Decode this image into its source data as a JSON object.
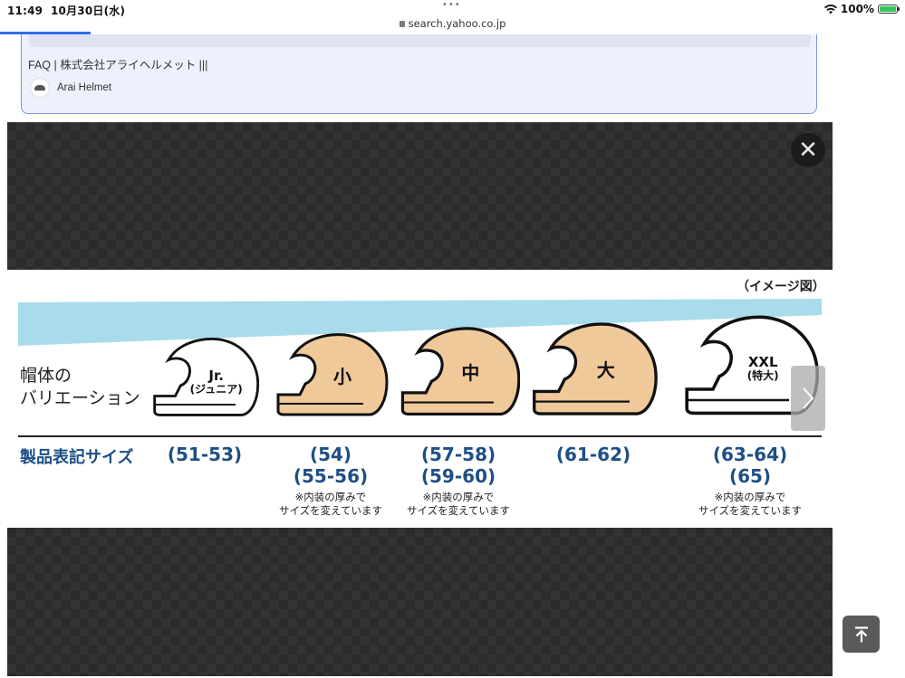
{
  "status_bar": {
    "time": "11:49",
    "date": "10月30日(水)",
    "dots": "•••",
    "url": "search.yahoo.co.jp",
    "battery": "100%",
    "progress_fraction": 0.1
  },
  "result_card": {
    "title": "FAQ | 株式会社アライヘルメット |||",
    "site_name": "Arai Helmet"
  },
  "viewer": {
    "close_glyph": "✕",
    "image": {
      "note": "（イメージ図）",
      "shell_label_line1": "帽体の",
      "shell_label_line2": "バリエーション",
      "product_label": "製品表記サイズ",
      "helmets": [
        {
          "label": "Jr.",
          "sublabel": "(ジュニア)",
          "color": "#ffffff",
          "sizes": [
            "(51-53)"
          ],
          "note": [
            "",
            ""
          ]
        },
        {
          "label": "小",
          "sublabel": "",
          "color": "#f0c99a",
          "sizes": [
            "(54)",
            "(55-56)"
          ],
          "note": [
            "※内装の厚みで",
            "サイズを変えています"
          ]
        },
        {
          "label": "中",
          "sublabel": "",
          "color": "#f0c99a",
          "sizes": [
            "(57-58)",
            "(59-60)"
          ],
          "note": [
            "※内装の厚みで",
            "サイズを変えています"
          ]
        },
        {
          "label": "大",
          "sublabel": "",
          "color": "#f0c99a",
          "sizes": [
            "(61-62)"
          ],
          "note": [
            "",
            ""
          ]
        },
        {
          "label": "XXL",
          "sublabel": "(特大)",
          "color": "#ffffff",
          "sizes": [
            "(63-64)",
            "(65)"
          ],
          "note": [
            "※内装の厚みで",
            "サイズを変えています"
          ]
        }
      ]
    }
  },
  "colors": {
    "accent_blue": "#1d4f86",
    "wedge": "#a9dcea",
    "helmet_tan": "#f0c99a"
  }
}
